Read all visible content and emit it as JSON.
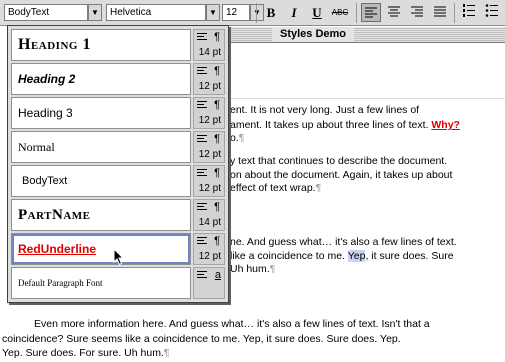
{
  "toolbar": {
    "style_value": "BodyText",
    "font_value": "Helvetica",
    "size_value": "12",
    "bold_label": "B",
    "italic_label": "I",
    "underline_label": "U",
    "strike_label": "ABC"
  },
  "window": {
    "title": "Styles Demo"
  },
  "document": {
    "lines": [
      {
        "text": "ent. It is not very long. Just a few lines of"
      },
      {
        "text": "ament. It takes up about three lines of text.",
        "red": "Why?"
      },
      {
        "text": "o.",
        "pilcrow": "¶"
      },
      {
        "text": "y text that continues to describe the document."
      },
      {
        "text": "on about the document. Again, it takes up about"
      },
      {
        "text": "effect of text wrap.",
        "pilcrow": "¶"
      },
      {
        "text": "ne. And guess what… it's also a few lines of text."
      },
      {
        "text": "like a coincidence to me. ",
        "hl": "Yep",
        "after": ", it sure does. Sure"
      },
      {
        "text": "Uh hum.",
        "pilcrow": "¶"
      },
      {
        "text": "Even more information here. And guess what… it's also a few lines of text. Isn't that a"
      },
      {
        "text": "coincidence? Sure seems like a coincidence to me. Yep, it sure does. Sure does. Yep."
      },
      {
        "text": "Yep. Sure does. For sure. Uh hum.",
        "pilcrow": "¶"
      }
    ]
  },
  "styles_menu": {
    "items": [
      {
        "name": "Heading 1",
        "size": "14 pt",
        "mark": "¶"
      },
      {
        "name": "Heading 2",
        "size": "12 pt",
        "mark": "¶"
      },
      {
        "name": "Heading 3",
        "size": "12 pt",
        "mark": "¶"
      },
      {
        "name": "Normal",
        "size": "12 pt",
        "mark": "¶"
      },
      {
        "name": "BodyText",
        "size": "12 pt",
        "mark": "¶"
      },
      {
        "name": "PartName",
        "size": "14 pt",
        "mark": "¶"
      },
      {
        "name": "RedUnderline",
        "size": "12 pt",
        "mark": "¶"
      },
      {
        "name": "Default Paragraph Font",
        "size": "",
        "mark": "a"
      }
    ]
  },
  "colors": {
    "red_style": "#e00000",
    "selection_highlight": "#c9d3f2"
  }
}
